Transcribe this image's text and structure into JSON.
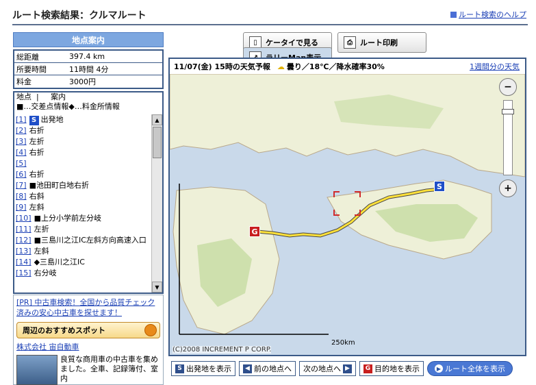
{
  "header": {
    "title": "ルート検索結果：クルマルート",
    "help_link": "ルート検索のヘルプ"
  },
  "toolbar": {
    "rally_map": "ラリーMap表示",
    "mobile": "ケータイで見る",
    "print": "ルート印刷"
  },
  "panel": {
    "title": "地点案内",
    "summary": [
      {
        "k": "総距離",
        "v": "397.4 km"
      },
      {
        "k": "所要時間",
        "v": "11時間 4分"
      },
      {
        "k": "料金",
        "v": "3000円"
      }
    ],
    "list_header": "地点  |     案内",
    "legend": "■…交差点情報◆…料金所情報",
    "items": [
      {
        "num": "[1]",
        "text": "出発地",
        "badge": "S"
      },
      {
        "num": "[2]",
        "text": "右折"
      },
      {
        "num": "[3]",
        "text": "左折"
      },
      {
        "num": "[4]",
        "text": "右折"
      },
      {
        "num": "[5]",
        "text": ""
      },
      {
        "num": "[6]",
        "text": "右折"
      },
      {
        "num": "[7]",
        "text": "■池田町白地右折"
      },
      {
        "num": "[8]",
        "text": "右斜"
      },
      {
        "num": "[9]",
        "text": "左斜"
      },
      {
        "num": "[10]",
        "text": "■上分小学前左分岐"
      },
      {
        "num": "[11]",
        "text": "左折"
      },
      {
        "num": "[12]",
        "text": "■三島川之江IC左斜方向高速入口"
      },
      {
        "num": "[13]",
        "text": "左斜"
      },
      {
        "num": "[14]",
        "text": "◆三島川之江IC"
      },
      {
        "num": "[15]",
        "text": "右分岐"
      }
    ]
  },
  "ad": {
    "pr_text": "[PR] 中古車検索！全国から品質チェック済みの安心中古車を探せます！",
    "spot_button": "周辺のおすすめスポット",
    "company": "株式会社 宙自動車",
    "desc": "良質な商用車の中古車を集めました。全車、記録簿付、室内"
  },
  "weather": {
    "text": "11/07(金) 15時の天気予報",
    "condition": "曇り／18℃／降水確率30%",
    "weekly_link": "1週間分の天気"
  },
  "map": {
    "copyright": "(C)2008 INCREMENT P CORP.",
    "scale": "250km",
    "start_marker": "S",
    "goal_marker": "G"
  },
  "bottom": {
    "show_start": "出発地を表示",
    "prev": "前の地点へ",
    "next": "次の地点へ",
    "show_goal": "目的地を表示",
    "show_all": "ルート全体を表示"
  }
}
